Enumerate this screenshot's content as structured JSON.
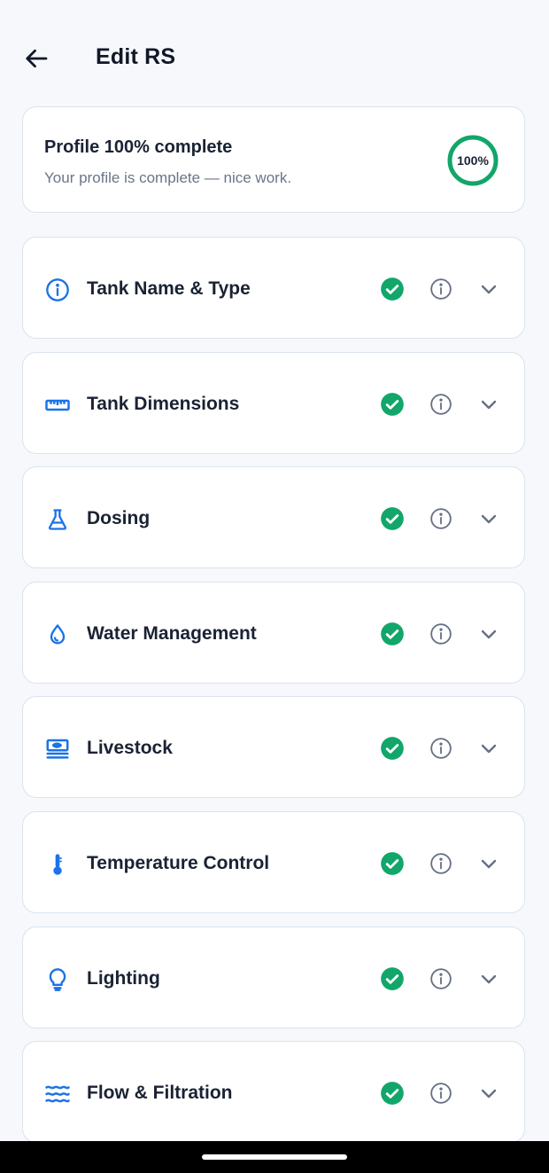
{
  "header": {
    "title": "Edit RS"
  },
  "profile": {
    "title": "Profile 100% complete",
    "subtitle": "Your profile is complete — nice work.",
    "progress_label": "100%",
    "progress_fraction": 1.0,
    "progress_color": "#12a66a"
  },
  "colors": {
    "accent": "#1a73e8",
    "success": "#12a66a",
    "muted": "#667085"
  },
  "sections": [
    {
      "label": "Tank Name & Type",
      "icon": "info-circle-icon",
      "complete": true
    },
    {
      "label": "Tank Dimensions",
      "icon": "ruler-icon",
      "complete": true
    },
    {
      "label": "Dosing",
      "icon": "flask-icon",
      "complete": true
    },
    {
      "label": "Water Management",
      "icon": "water-drop-icon",
      "complete": true
    },
    {
      "label": "Livestock",
      "icon": "fish-tank-icon",
      "complete": true
    },
    {
      "label": "Temperature Control",
      "icon": "thermometer-icon",
      "complete": true
    },
    {
      "label": "Lighting",
      "icon": "lightbulb-icon",
      "complete": true
    },
    {
      "label": "Flow & Filtration",
      "icon": "waves-icon",
      "complete": true
    }
  ]
}
